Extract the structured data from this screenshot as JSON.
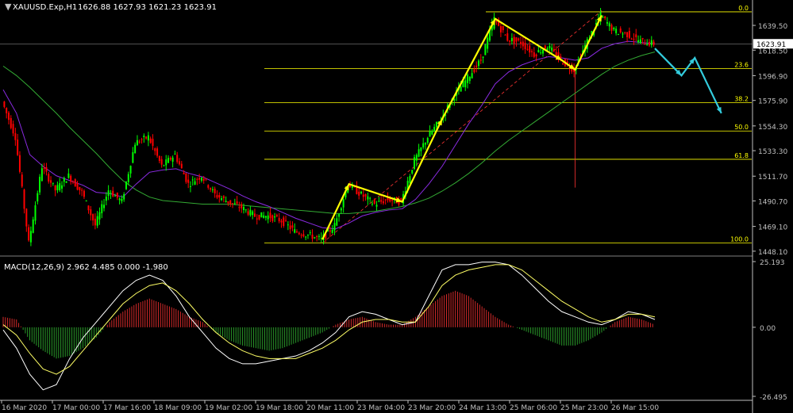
{
  "header": {
    "symbol_label": "XAUUSD.Exp,H1",
    "ohlc_label": "1626.88 1627.93 1621.23 1623.91"
  },
  "macd_label": "MACD(12,26,9) 2.962 4.485 0.000 -1.980",
  "colors": {
    "background": "#000000",
    "axis": "#c0c0c0",
    "bull": "#00ff00",
    "bear": "#ff0000",
    "fib": "#ffff00",
    "arrow_yellow": "#ffff00",
    "arrow_cyan": "#33ccdd",
    "ma_green": "#33aa33",
    "ma_purple": "#8a2be2",
    "ma_white": "#ffffff",
    "ma_yellow": "#ffff66",
    "macd_pos": "#d42a2a",
    "macd_neg": "#2a9a2a",
    "trend_dash": "#ff3333",
    "current_line": "#a0a0a0"
  },
  "chart_data": [
    {
      "type": "candlestick",
      "symbol": "XAUUSD.Exp",
      "timeframe": "H1",
      "x_tick_labels": [
        "16 Mar 2020",
        "17 Mar 00:00",
        "17 Mar 16:00",
        "18 Mar 09:00",
        "19 Mar 02:00",
        "19 Mar 18:00",
        "20 Mar 11:00",
        "23 Mar 04:00",
        "23 Mar 20:00",
        "24 Mar 13:00",
        "25 Mar 06:00",
        "25 Mar 23:00",
        "26 Mar 15:00"
      ],
      "y_tick_labels": [
        "1639.50",
        "1618.50",
        "1596.90",
        "1575.90",
        "1554.30",
        "1533.30",
        "1511.70",
        "1490.70",
        "1469.10",
        "1448.10"
      ],
      "ylim": [
        1446,
        1657
      ],
      "current_price_label": "1623.91",
      "fibonacci": {
        "levels": [
          {
            "label": "0.0",
            "price": 1651
          },
          {
            "label": "23.6",
            "price": 1603
          },
          {
            "label": "38.2",
            "price": 1574
          },
          {
            "label": "50.0",
            "price": 1550
          },
          {
            "label": "61.8",
            "price": 1526
          },
          {
            "label": "100.0",
            "price": 1455
          }
        ]
      },
      "price_path": [
        [
          0,
          1575
        ],
        [
          1,
          1545
        ],
        [
          2,
          1455
        ],
        [
          3,
          1520
        ],
        [
          4,
          1500
        ],
        [
          5,
          1512
        ],
        [
          6,
          1498
        ],
        [
          7,
          1470
        ],
        [
          8,
          1500
        ],
        [
          9,
          1490
        ],
        [
          10,
          1540
        ],
        [
          11,
          1545
        ],
        [
          12,
          1520
        ],
        [
          13,
          1530
        ],
        [
          14,
          1505
        ],
        [
          15,
          1512
        ],
        [
          16,
          1496
        ],
        [
          17,
          1490
        ],
        [
          18,
          1485
        ],
        [
          19,
          1478
        ],
        [
          20,
          1478
        ],
        [
          21,
          1474
        ],
        [
          22,
          1465
        ],
        [
          23,
          1462
        ],
        [
          24,
          1458
        ],
        [
          25,
          1470
        ],
        [
          26,
          1505
        ],
        [
          27,
          1496
        ],
        [
          28,
          1488
        ],
        [
          29,
          1492
        ],
        [
          30,
          1490
        ],
        [
          31,
          1525
        ],
        [
          32,
          1545
        ],
        [
          33,
          1560
        ],
        [
          34,
          1580
        ],
        [
          35,
          1595
        ],
        [
          36,
          1610
        ],
        [
          37,
          1645
        ],
        [
          38,
          1628
        ],
        [
          39,
          1625
        ],
        [
          40,
          1615
        ],
        [
          41,
          1622
        ],
        [
          42,
          1610
        ],
        [
          43,
          1602
        ],
        [
          44,
          1626
        ],
        [
          45,
          1648
        ],
        [
          46,
          1635
        ],
        [
          47,
          1632
        ],
        [
          48,
          1626
        ],
        [
          49,
          1624
        ]
      ],
      "moving_averages": [
        {
          "color_key": "ma_green",
          "values": [
            1605,
            1597,
            1587,
            1576,
            1565,
            1553,
            1542,
            1531,
            1519,
            1508,
            1500,
            1494,
            1491,
            1490,
            1489,
            1488,
            1488,
            1488,
            1487,
            1486,
            1485,
            1484,
            1483,
            1482,
            1481,
            1480,
            1480,
            1481,
            1482,
            1484,
            1486,
            1489,
            1493,
            1499,
            1506,
            1514,
            1523,
            1533,
            1542,
            1550,
            1558,
            1566,
            1574,
            1582,
            1590,
            1598,
            1605,
            1610,
            1614,
            1617
          ]
        },
        {
          "color_key": "ma_purple",
          "values": [
            1585,
            1565,
            1530,
            1520,
            1512,
            1508,
            1504,
            1498,
            1497,
            1494,
            1505,
            1515,
            1517,
            1518,
            1514,
            1511,
            1506,
            1501,
            1495,
            1490,
            1486,
            1481,
            1476,
            1472,
            1468,
            1467,
            1472,
            1478,
            1481,
            1483,
            1484,
            1492,
            1505,
            1520,
            1538,
            1556,
            1572,
            1590,
            1600,
            1606,
            1610,
            1613,
            1612,
            1610,
            1612,
            1620,
            1624,
            1626,
            1625,
            1624
          ]
        }
      ],
      "projection_arrows": [
        {
          "color_key": "arrow_cyan",
          "points": [
            [
              49,
              1620
            ],
            [
              51,
              1597
            ],
            [
              52,
              1612
            ],
            [
              54,
              1565
            ]
          ]
        }
      ],
      "pattern_arrows": [
        {
          "color_key": "arrow_yellow",
          "points": [
            [
              24,
              1458
            ],
            [
              26,
              1505
            ],
            [
              30,
              1490
            ],
            [
              33,
              1560
            ],
            [
              37,
              1645
            ],
            [
              42,
              1610
            ],
            [
              43,
              1602
            ],
            [
              45,
              1648
            ]
          ]
        }
      ]
    },
    {
      "type": "macd",
      "title": "MACD(12,26,9) 2.962 4.485 0.000 -1.980",
      "params": [
        12,
        26,
        9
      ],
      "values": {
        "macd": 2.962,
        "signal": 4.485,
        "level": 0.0,
        "histogram": -1.98
      },
      "y_tick_labels": [
        "25.193",
        "0.00",
        "-26.495"
      ],
      "ylim": [
        -26.495,
        25.193
      ],
      "histogram": [
        4,
        3,
        -5,
        -9,
        -12,
        -11,
        -8,
        -4,
        2,
        6,
        9,
        11,
        9,
        7,
        4,
        2,
        -2,
        -5,
        -7,
        -8,
        -9,
        -8,
        -6,
        -4,
        -2,
        1,
        3,
        4,
        2,
        1,
        1,
        4,
        8,
        12,
        14,
        12,
        8,
        4,
        1,
        -1,
        -3,
        -5,
        -7,
        -7,
        -5,
        -2,
        2,
        4,
        3,
        1
      ],
      "macd_line": [
        -1,
        -8,
        -18,
        -24,
        -22,
        -12,
        -4,
        2,
        8,
        14,
        18,
        20,
        18,
        12,
        4,
        -2,
        -8,
        -12,
        -14,
        -14,
        -13,
        -12,
        -11,
        -9,
        -6,
        -2,
        4,
        6,
        5,
        3,
        1,
        2,
        12,
        22,
        24,
        24,
        25,
        25,
        24,
        20,
        15,
        10,
        6,
        4,
        2,
        1,
        3,
        6,
        5,
        3
      ],
      "signal_line": [
        1,
        -3,
        -10,
        -16,
        -18,
        -15,
        -9,
        -3,
        3,
        9,
        13,
        16,
        17,
        14,
        9,
        3,
        -2,
        -6,
        -9,
        -11,
        -12,
        -12,
        -12,
        -10,
        -8,
        -5,
        -1,
        2,
        3,
        3,
        2,
        2,
        8,
        16,
        20,
        22,
        23,
        24,
        24,
        22,
        18,
        14,
        10,
        7,
        4,
        2,
        3,
        5,
        5,
        4
      ]
    }
  ]
}
